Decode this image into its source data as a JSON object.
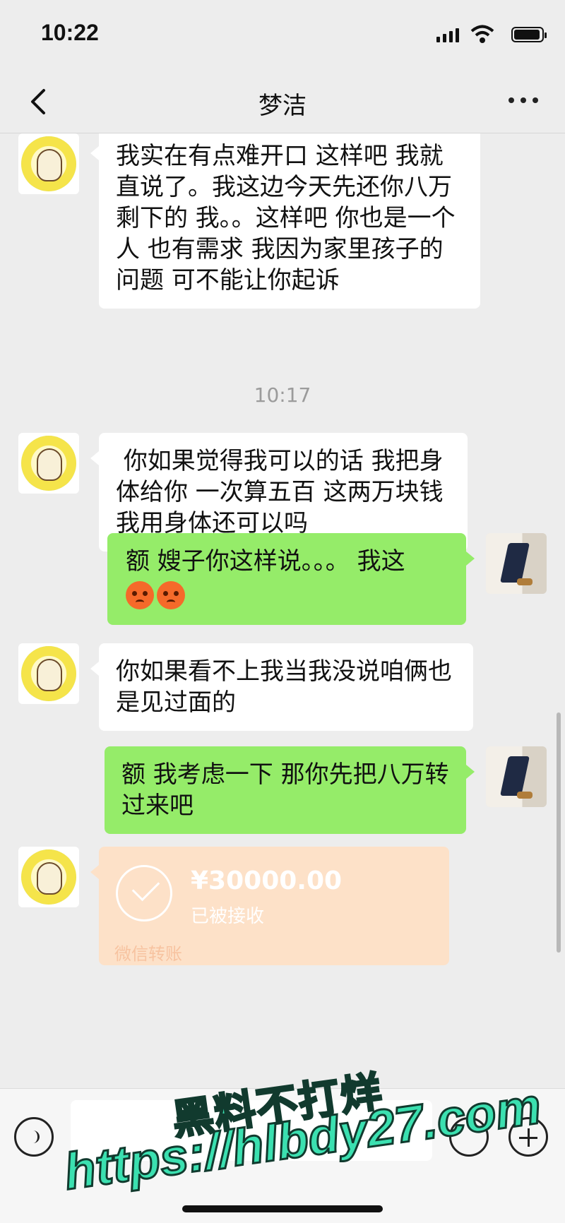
{
  "status_bar": {
    "time": "10:22"
  },
  "header": {
    "title": "梦洁"
  },
  "messages": [
    {
      "side": "left",
      "text": "我实在有点难开口 这样吧 我就直说了。我这边今天先还你八万 剩下的 我。。这样吧 你也是一个人 也有需求 我因为家里孩子的问题 可不能让你起诉"
    },
    {
      "timestamp": "10:17"
    },
    {
      "side": "left",
      "text": " 你如果觉得我可以的话 我把身体给你 一次算五百 这两万块钱我用身体还可以吗"
    },
    {
      "side": "right",
      "text": "额 嫂子你这样说。。。 我这"
    },
    {
      "side": "left",
      "text": "你如果看不上我当我没说咱俩也是见过面的"
    },
    {
      "side": "right",
      "text": "额 我考虑一下 那你先把八万转过来吧"
    }
  ],
  "transfer": {
    "amount": "¥30000.00",
    "status": "已被接收",
    "label": "微信转账"
  },
  "watermark": {
    "line1": "黑料不打烊",
    "line2": "https://hlbdy27.com"
  },
  "colors": {
    "incoming_bubble": "#ffffff",
    "outgoing_bubble": "#95ec69",
    "transfer_card": "#fde1c8",
    "background": "#ededed"
  }
}
